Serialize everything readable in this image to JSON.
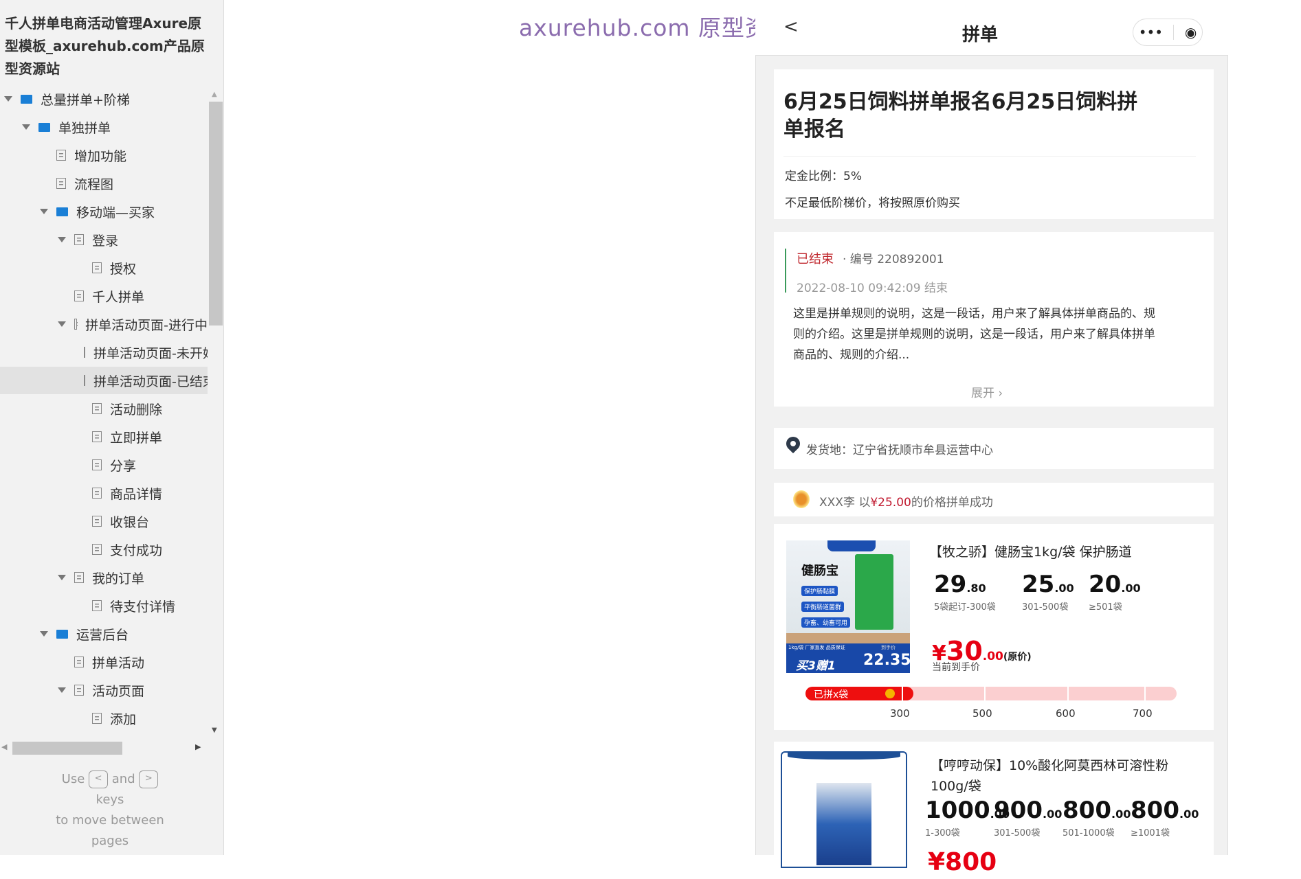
{
  "sidebar": {
    "project_title": "千人拼单电商活动管理Axure原型模板_axurehub.com产品原型资源站",
    "tree": [
      {
        "label": "总量拼单+阶梯",
        "type": "folder",
        "level": 0,
        "expanded": true
      },
      {
        "label": "单独拼单",
        "type": "folder",
        "level": 1,
        "expanded": true
      },
      {
        "label": "增加功能",
        "type": "page",
        "level": 2
      },
      {
        "label": "流程图",
        "type": "page",
        "level": 2
      },
      {
        "label": "移动端—买家",
        "type": "folder",
        "level": 2,
        "expanded": true
      },
      {
        "label": "登录",
        "type": "page",
        "level": 3,
        "expanded": true
      },
      {
        "label": "授权",
        "type": "page",
        "level": 4
      },
      {
        "label": "千人拼单",
        "type": "page",
        "level": 3
      },
      {
        "label": "拼单活动页面-进行中",
        "type": "page",
        "level": 3,
        "expanded": true
      },
      {
        "label": "拼单活动页面-未开始",
        "type": "page",
        "level": 4
      },
      {
        "label": "拼单活动页面-已结束",
        "type": "page",
        "level": 4,
        "selected": true
      },
      {
        "label": "活动删除",
        "type": "page",
        "level": 4
      },
      {
        "label": "立即拼单",
        "type": "page",
        "level": 4
      },
      {
        "label": "分享",
        "type": "page",
        "level": 4
      },
      {
        "label": "商品详情",
        "type": "page",
        "level": 4
      },
      {
        "label": "收银台",
        "type": "page",
        "level": 4
      },
      {
        "label": "支付成功",
        "type": "page",
        "level": 4
      },
      {
        "label": "我的订单",
        "type": "page",
        "level": 3,
        "expanded": true
      },
      {
        "label": "待支付详情",
        "type": "page",
        "level": 4
      },
      {
        "label": "运营后台",
        "type": "folder",
        "level": 2,
        "expanded": true
      },
      {
        "label": "拼单活动",
        "type": "page",
        "level": 3
      },
      {
        "label": "活动页面",
        "type": "page",
        "level": 3,
        "expanded": true
      },
      {
        "label": "添加",
        "type": "page",
        "level": 4
      }
    ],
    "footer": {
      "use": "Use",
      "key_prev": "<",
      "and": "and",
      "key_next": ">",
      "keys": "keys",
      "line2": "to move between",
      "line3": "pages"
    }
  },
  "watermark": "axurehub.com 原型资源站",
  "mobile": {
    "nav": {
      "title": "拼单",
      "more_icon": "•••",
      "target_icon": "◉",
      "back_icon": "<"
    },
    "activity": {
      "title": "6月25日饲料拼单报名6月25日饲料拼单报名",
      "deposit": "定金比例：5%",
      "note": "不足最低阶梯价，将按照原价购买"
    },
    "status": {
      "state": "已结束",
      "code": "· 编号 220892001",
      "end_time": "2022-08-10 09:42:09 结束",
      "description": "这里是拼单规则的说明，这是一段话，用户来了解具体拼单商品的、规则的介绍。这里是拼单规则的说明，这是一段话，用户来了解具体拼单商品的、规则的介绍...",
      "expand": "展开"
    },
    "ship_from": "发货地：辽宁省抚顺市牟县运营中心",
    "notice": {
      "user": "XXX李",
      "pre": "以",
      "price": "¥25.00",
      "post": "的价格拼单成功"
    },
    "products": [
      {
        "name": "【牧之骄】健肠宝1kg/袋  保护肠道",
        "image_text": {
          "brand": "健肠宝",
          "promo": "买3赠1",
          "price": "22.35",
          "tags": [
            "保护肠黏膜",
            "平衡肠道菌群",
            "孕畜、幼畜可用"
          ],
          "bottom": "1kg/袋  厂家直发 品质保证",
          "hand": "到手价"
        },
        "tiers": [
          {
            "int": "29",
            "dec": ".80",
            "range": "5袋起订-300袋"
          },
          {
            "int": "25",
            "dec": ".00",
            "range": "301-500袋"
          },
          {
            "int": "20",
            "dec": ".00",
            "range": "≥501袋"
          }
        ],
        "price": {
          "symbol": "¥",
          "int": "30",
          "dec": ".00",
          "tag": "(原价)",
          "label": "当前到手价"
        },
        "progress": {
          "label": "已拼x袋",
          "fraction": 0.29,
          "ticks": [
            "300",
            "500",
            "600",
            "700"
          ]
        }
      },
      {
        "name": "【哼哼动保】10%酸化阿莫西林可溶性粉100g/袋",
        "tiers": [
          {
            "int": "1000",
            "dec": ".00",
            "range": "1-300袋"
          },
          {
            "int": "900",
            "dec": ".00",
            "range": "301-500袋"
          },
          {
            "int": "800",
            "dec": ".00",
            "range": "501-1000袋"
          },
          {
            "int": "800",
            "dec": ".00",
            "range": "≥1001袋"
          }
        ],
        "price": {
          "partial": "¥800"
        }
      }
    ]
  },
  "colors": {
    "folder": "#1a7fd6",
    "accent_red": "#e60012",
    "watermark": "#8b6cae",
    "ended": "#c0282e"
  }
}
